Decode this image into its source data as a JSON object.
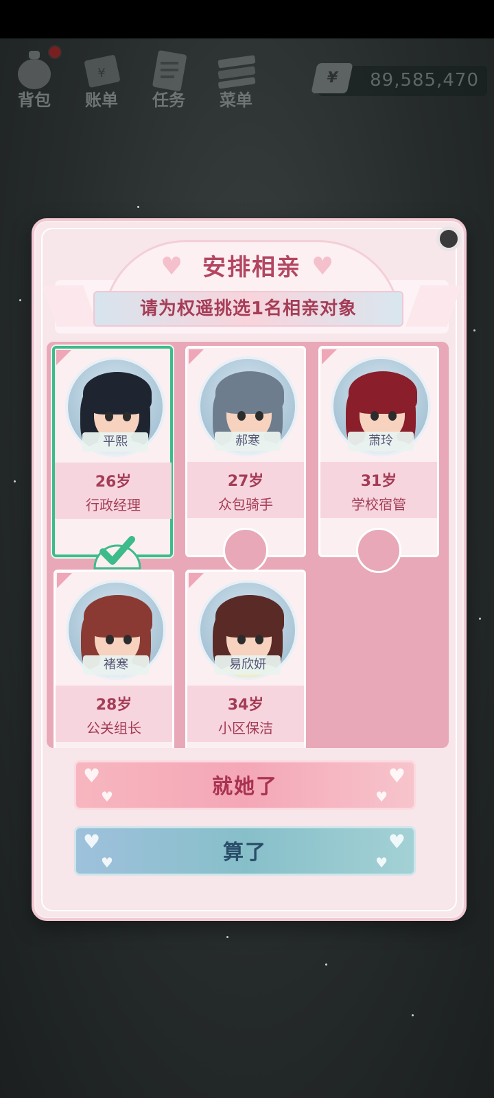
{
  "nav": {
    "items": [
      {
        "label": "背包",
        "icon": "backpack-icon"
      },
      {
        "label": "账单",
        "icon": "bill-icon"
      },
      {
        "label": "任务",
        "icon": "task-icon"
      },
      {
        "label": "菜单",
        "icon": "menu-icon"
      }
    ],
    "money": {
      "symbol": "¥",
      "amount": "89,585,470"
    }
  },
  "dialog": {
    "title": "安排相亲",
    "subtitle": "请为权遥挑选1名相亲对象",
    "candidates": [
      {
        "name": "平熙",
        "age": "26岁",
        "job": "行政经理",
        "selected": true,
        "hair": "#1f2530"
      },
      {
        "name": "郝寒",
        "age": "27岁",
        "job": "众包骑手",
        "selected": false,
        "hair": "#6e7d8e"
      },
      {
        "name": "萧玲",
        "age": "31岁",
        "job": "学校宿管",
        "selected": false,
        "hair": "#8a1e2b"
      },
      {
        "name": "褚寒",
        "age": "28岁",
        "job": "公关组长",
        "selected": false,
        "hair": "#8a3a32"
      },
      {
        "name": "易欣妍",
        "age": "34岁",
        "job": "小区保洁",
        "selected": false,
        "hair": "#5a2a26"
      }
    ],
    "confirm_label": "就她了",
    "cancel_label": "算了"
  },
  "colors": {
    "accent": "#a43c55",
    "selected_border": "#3dbb8a"
  }
}
